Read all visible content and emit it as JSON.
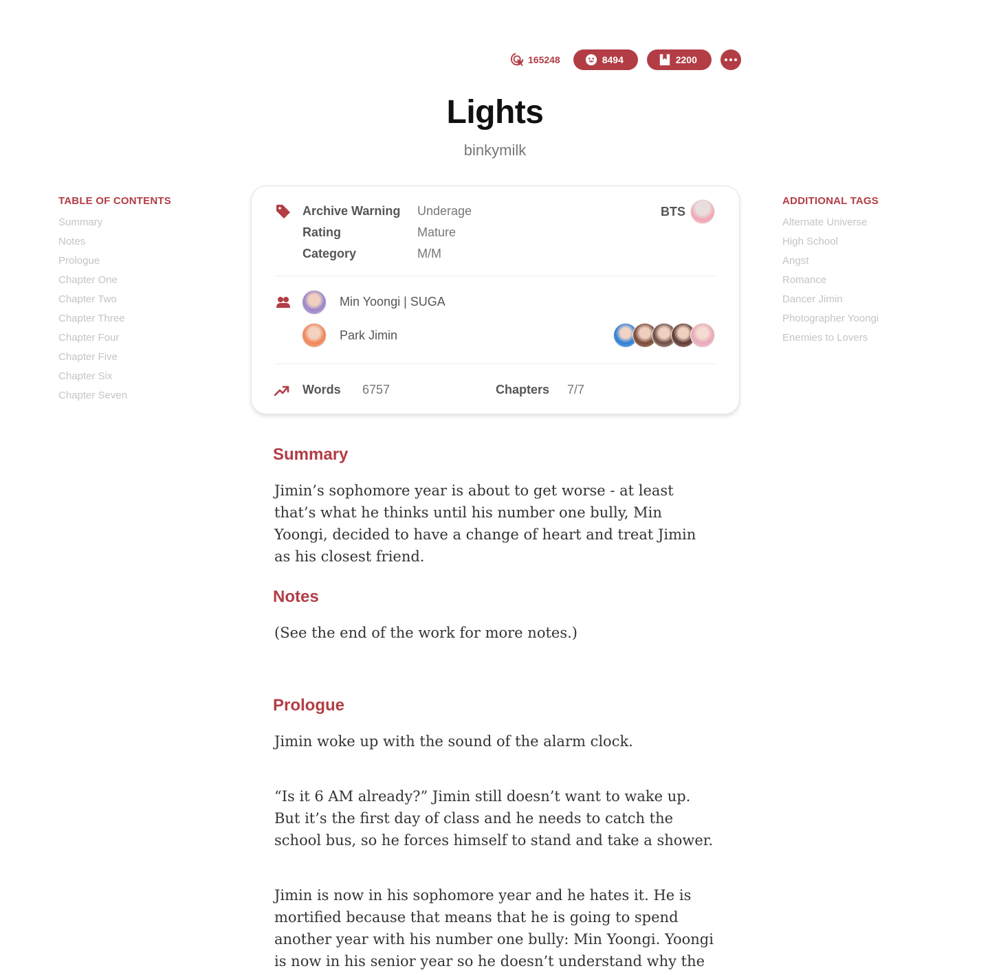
{
  "stats": {
    "hits": "165248",
    "kudos": "8494",
    "bookmarks": "2200",
    "accent_color": "#b23d45"
  },
  "work": {
    "title": "Lights",
    "author": "binkymilk"
  },
  "toc": {
    "heading": "TABLE OF CONTENTS",
    "items": [
      "Summary",
      "Notes",
      "Prologue",
      "Chapter One",
      "Chapter Two",
      "Chapter Three",
      "Chapter Four",
      "Chapter Five",
      "Chapter Six",
      "Chapter Seven"
    ]
  },
  "tags": {
    "heading": "ADDITIONAL TAGS",
    "items": [
      "Alternate Universe",
      "High School",
      "Angst",
      "Romance",
      "Dancer Jimin",
      "Photographer Yoongi",
      "Enemies to Lovers"
    ]
  },
  "card": {
    "warning_label": "Archive Warning",
    "warning_value": "Underage",
    "rating_label": "Rating",
    "rating_value": "Mature",
    "category_label": "Category",
    "category_value": "M/M",
    "fandom": "BTS",
    "characters": [
      "Min Yoongi | SUGA",
      "Park Jimin"
    ],
    "words_label": "Words",
    "words_value": "6757",
    "chapters_label": "Chapters",
    "chapters_value": "7/7"
  },
  "content": {
    "summary_heading": "Summary",
    "summary_text": "Jimin’s sophomore year is about to get worse - at least that’s what he thinks until his number one bully, Min Yoongi, decided to have a change of heart and treat Jimin as his closest friend.",
    "notes_heading": "Notes",
    "notes_text": "(See the end of the work for more notes.)",
    "prologue_heading": "Prologue",
    "prologue_p1": "Jimin woke up with the sound of the alarm clock.",
    "prologue_p2": "“Is it 6 AM already?” Jimin still doesn’t want to wake up. But it’s the first day of class and he needs to catch the school bus, so he forces himself to stand and take a shower.",
    "prologue_p3": "Jimin is now in his sophomore year and he hates it. He is mortified because that means that he is going to spend another year with his number one bully: Min Yoongi. Yoongi is now in his senior year so he doesn’t understand why the elder is always"
  }
}
